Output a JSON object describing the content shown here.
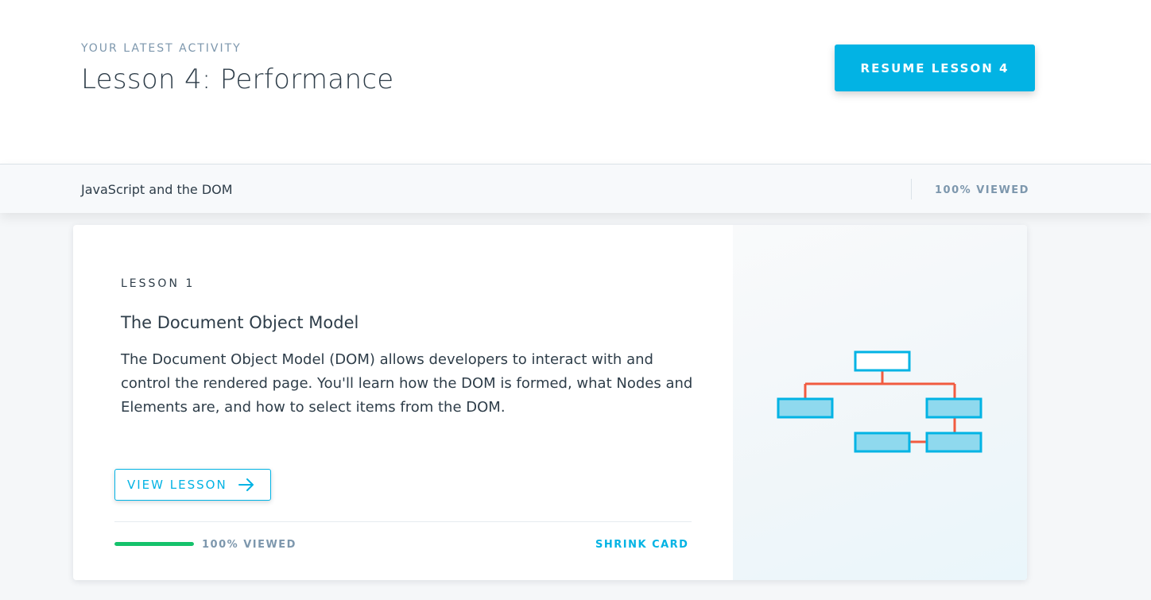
{
  "header": {
    "eyebrow": "YOUR LATEST ACTIVITY",
    "title": "Lesson 4: Performance",
    "resume_label": "RESUME LESSON 4"
  },
  "course_bar": {
    "name": "JavaScript and the DOM",
    "viewed": "100% VIEWED"
  },
  "card": {
    "label": "LESSON 1",
    "title": "The Document Object Model",
    "description": "The Document Object Model (DOM) allows developers to interact with and control the rendered page. You'll learn how the DOM is formed, what Nodes and Elements are, and how to select items from the DOM.",
    "view_label": "VIEW LESSON",
    "view_icon": "arrow-right-icon",
    "progress_percent": 100,
    "viewed": "100% VIEWED",
    "shrink_label": "SHRINK CARD",
    "illustration_icon": "dom-tree-icon"
  },
  "colors": {
    "accent": "#02b3e4",
    "progress": "#15c26b",
    "muted": "#7d97ad",
    "text": "#2e3d49",
    "tree_line": "#f15b40",
    "tree_node": "#02b3e4"
  }
}
